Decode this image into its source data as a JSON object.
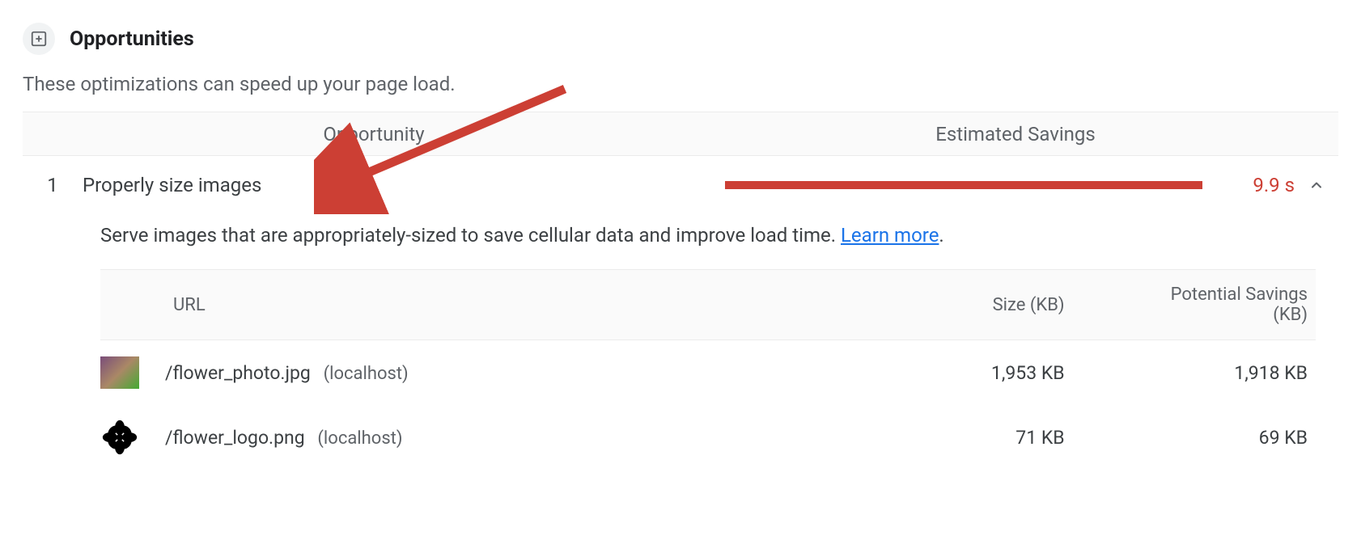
{
  "section": {
    "title": "Opportunities",
    "subtitle": "These optimizations can speed up your page load."
  },
  "columns": {
    "opportunity": "Opportunity",
    "savings": "Estimated Savings"
  },
  "opportunity": {
    "index": "1",
    "title": "Properly size images",
    "savings_value": "9.9 s",
    "description_prefix": "Serve images that are appropriately-sized to save cellular data and improve load time. ",
    "learn_more_label": "Learn more",
    "description_suffix": "."
  },
  "table": {
    "headers": {
      "url": "URL",
      "size": "Size (KB)",
      "potential": "Potential Savings (KB)"
    },
    "rows": [
      {
        "path": "/flower_photo.jpg",
        "host": "(localhost)",
        "size": "1,953 KB",
        "potential": "1,918 KB"
      },
      {
        "path": "/flower_logo.png",
        "host": "(localhost)",
        "size": "71 KB",
        "potential": "69 KB"
      }
    ]
  },
  "colors": {
    "accent_red": "#cc3f34",
    "link_blue": "#1a73e8"
  }
}
